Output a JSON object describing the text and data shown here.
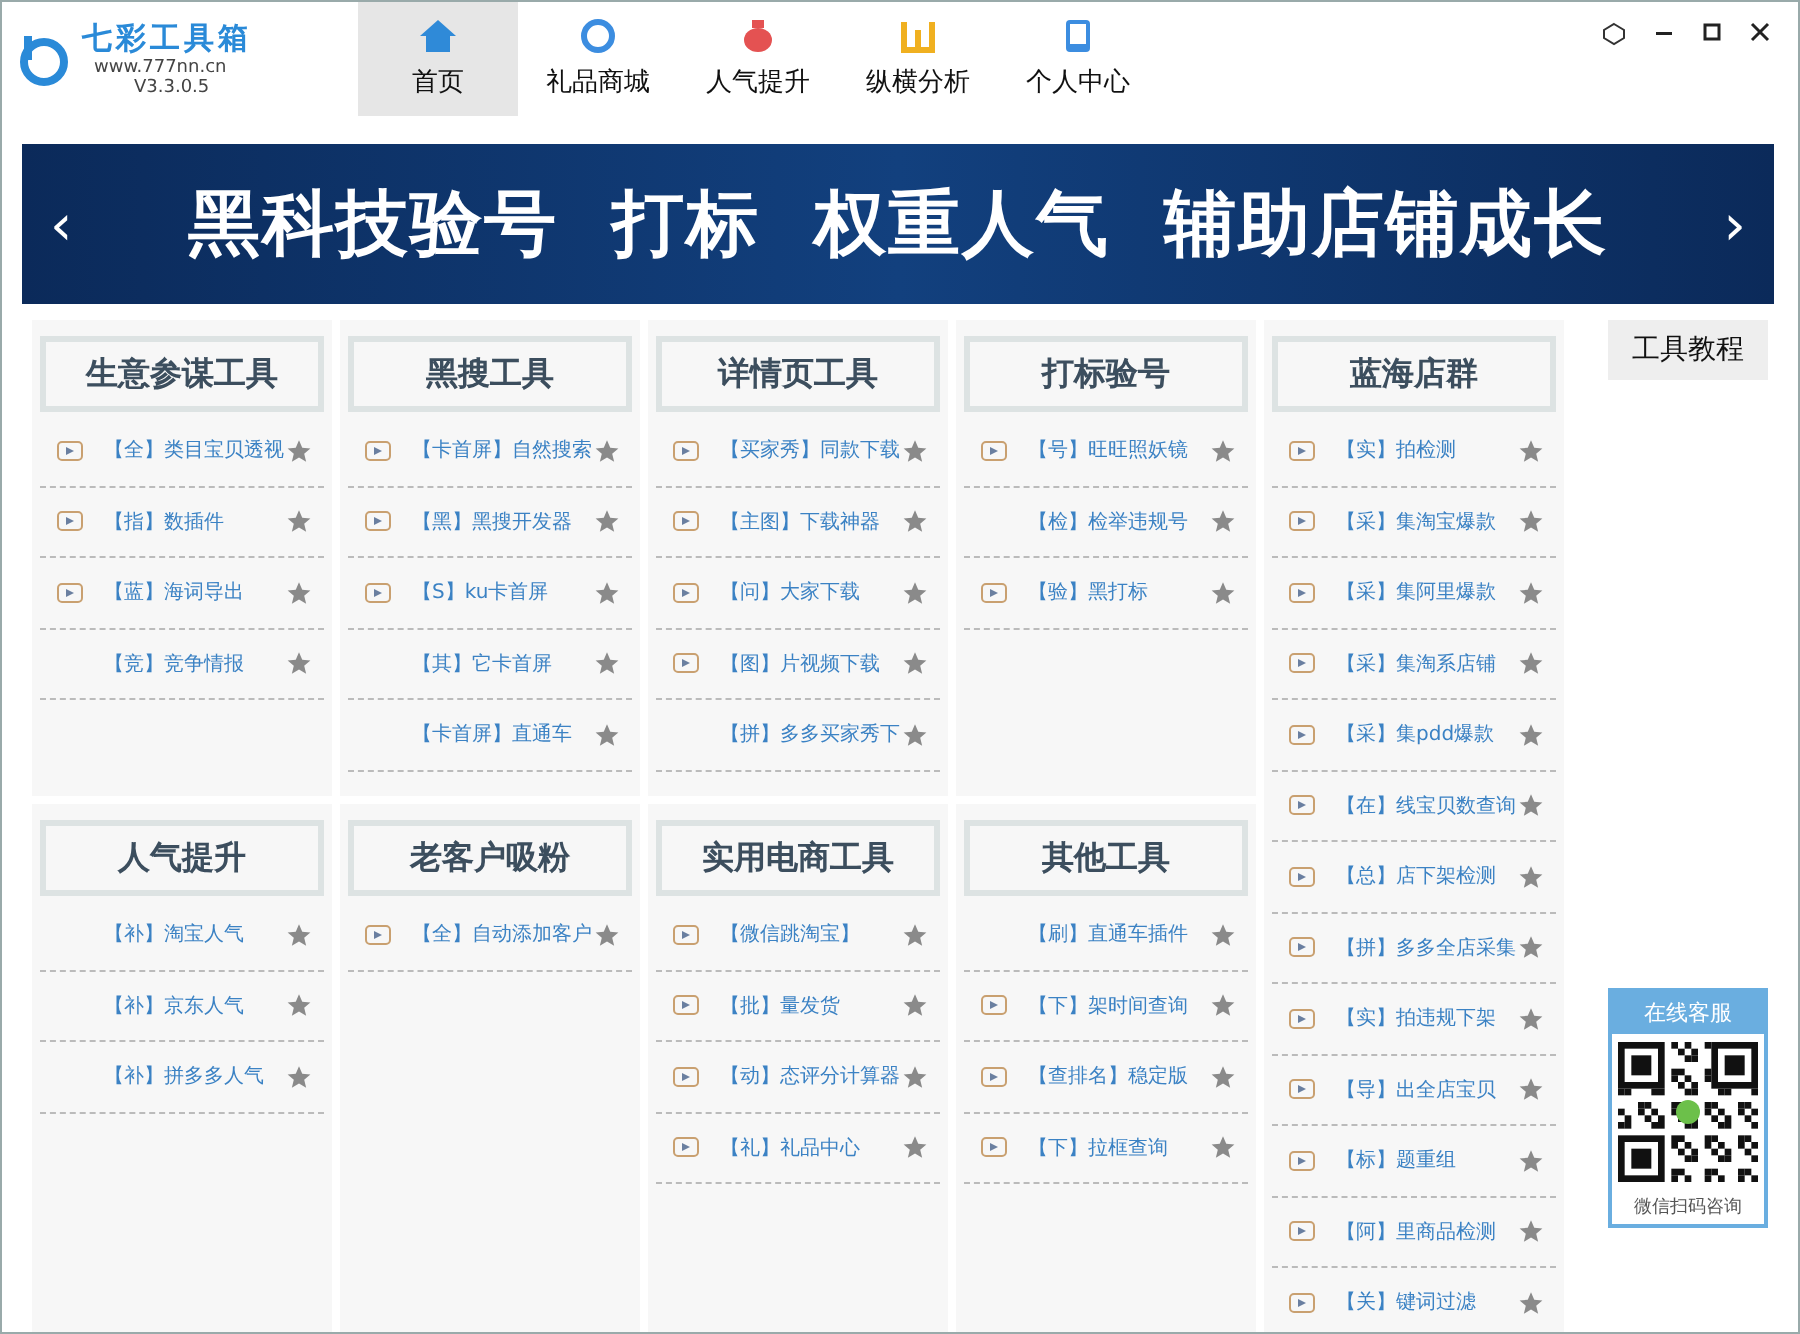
{
  "app": {
    "name": "七彩工具箱",
    "site": "www.777nn.cn",
    "version": "V3.3.0.5"
  },
  "tabs": [
    {
      "label": "首页",
      "selected": true
    },
    {
      "label": "礼品商城",
      "selected": false
    },
    {
      "label": "人气提升",
      "selected": false
    },
    {
      "label": "纵横分析",
      "selected": false
    },
    {
      "label": "个人中心",
      "selected": false
    }
  ],
  "banner": {
    "text": "黑科技验号  打标  权重人气  辅助店铺成长",
    "prev": "‹",
    "next": "›"
  },
  "groups": [
    {
      "title": "生意参谋工具",
      "items": [
        {
          "label": "【全】类目宝贝透视",
          "video": true
        },
        {
          "label": "【指】数插件",
          "video": true
        },
        {
          "label": "【蓝】海词导出",
          "video": true
        },
        {
          "label": "【竞】竞争情报",
          "video": false
        }
      ]
    },
    {
      "title": "黑搜工具",
      "items": [
        {
          "label": "【卡首屏】自然搜索",
          "video": true
        },
        {
          "label": "【黑】黑搜开发器",
          "video": true
        },
        {
          "label": "【S】ku卡首屏",
          "video": true
        },
        {
          "label": "【其】它卡首屏",
          "video": false
        },
        {
          "label": "【卡首屏】直通车",
          "video": false
        }
      ]
    },
    {
      "title": "详情页工具",
      "items": [
        {
          "label": "【买家秀】同款下载",
          "video": true
        },
        {
          "label": "【主图】下载神器",
          "video": true
        },
        {
          "label": "【问】大家下载",
          "video": true
        },
        {
          "label": "【图】片视频下载",
          "video": true
        },
        {
          "label": "【拼】多多买家秀下",
          "video": false
        }
      ]
    },
    {
      "title": "打标验号",
      "items": [
        {
          "label": "【号】旺旺照妖镜",
          "video": true
        },
        {
          "label": "【检】检举违规号",
          "video": false
        },
        {
          "label": "【验】黑打标",
          "video": true
        }
      ]
    },
    {
      "title": "蓝海店群",
      "items": [
        {
          "label": "【实】拍检测",
          "video": true
        },
        {
          "label": "【采】集淘宝爆款",
          "video": true
        },
        {
          "label": "【采】集阿里爆款",
          "video": true
        },
        {
          "label": "【采】集淘系店铺",
          "video": true
        },
        {
          "label": "【采】集pdd爆款",
          "video": true
        },
        {
          "label": "【在】线宝贝数查询",
          "video": true
        },
        {
          "label": "【总】店下架检测",
          "video": true
        },
        {
          "label": "【拼】多多全店采集",
          "video": true
        },
        {
          "label": "【实】拍违规下架",
          "video": true
        },
        {
          "label": "【导】出全店宝贝",
          "video": true
        },
        {
          "label": "【标】题重组",
          "video": true
        },
        {
          "label": "【阿】里商品检测",
          "video": true
        },
        {
          "label": "【关】键词过滤",
          "video": true
        }
      ]
    },
    {
      "title": "人气提升",
      "items": [
        {
          "label": "【补】淘宝人气",
          "video": false
        },
        {
          "label": "【补】京东人气",
          "video": false
        },
        {
          "label": "【补】拼多多人气",
          "video": false
        }
      ]
    },
    {
      "title": "老客户吸粉",
      "items": [
        {
          "label": "【全】自动添加客户",
          "video": true
        }
      ]
    },
    {
      "title": "实用电商工具",
      "items": [
        {
          "label": "【微信跳淘宝】",
          "video": true
        },
        {
          "label": "【批】量发货",
          "video": true
        },
        {
          "label": "【动】态评分计算器",
          "video": true
        },
        {
          "label": "【礼】礼品中心",
          "video": true
        }
      ]
    },
    {
      "title": "其他工具",
      "items": [
        {
          "label": "【刷】直通车插件",
          "video": false
        },
        {
          "label": "【下】架时间查询",
          "video": true
        },
        {
          "label": "【查排名】稳定版",
          "video": true
        },
        {
          "label": "【下】拉框查询",
          "video": true
        }
      ]
    }
  ],
  "side": {
    "tutorial": "工具教程",
    "service_title": "在线客服",
    "service_caption": "微信扫码咨询"
  }
}
